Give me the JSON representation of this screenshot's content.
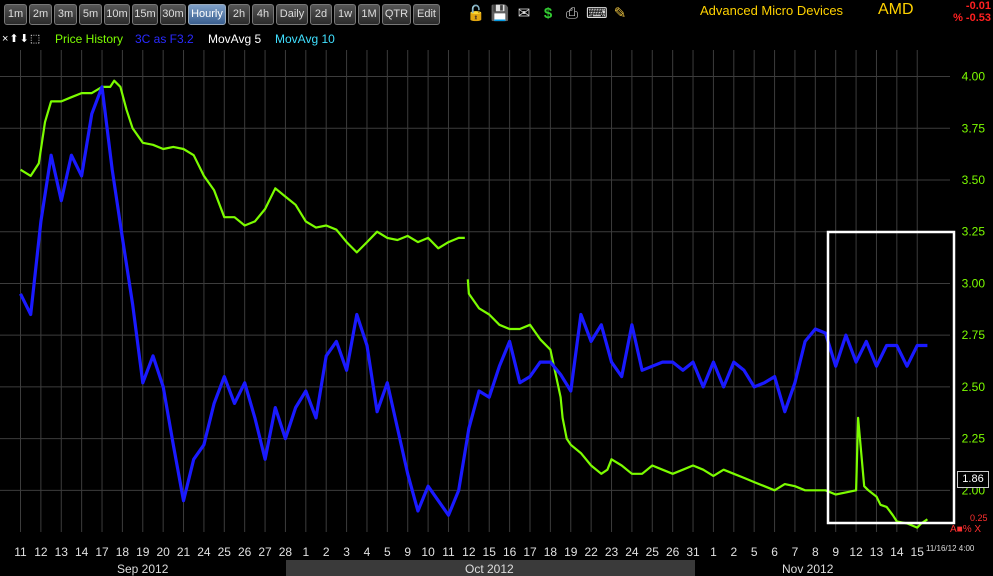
{
  "toolbar": {
    "timeframes": [
      "1m",
      "2m",
      "3m",
      "5m",
      "10m",
      "15m",
      "30m",
      "Hourly",
      "2h",
      "4h",
      "Daily",
      "2d",
      "1w",
      "1M",
      "QTR",
      "Edit"
    ],
    "active": "Hourly",
    "icons": [
      "lock-icon",
      "save-icon",
      "email-icon",
      "dollar-icon",
      "print-icon",
      "keyboard-icon",
      "pencil-icon"
    ],
    "company": "Advanced Micro Devices",
    "ticker": "AMD",
    "change": "-0.01",
    "change_pct": "% -0.53"
  },
  "legend": {
    "controls": "×⬆⬇⬚",
    "price_history": "Price History",
    "indicator": "3C as F3.2",
    "ma5": "MovAvg 5",
    "ma10": "MovAvg 10"
  },
  "colors": {
    "price": "#7cfc00",
    "indicator": "#1a1aff",
    "ma5": "#ffffff",
    "ma10": "#40e0ff",
    "axis_labels": "#7cfc00",
    "highlight_box": "#ffffff",
    "month_band_even": "#000000",
    "month_band_odd": "#3a3a3a"
  },
  "chart_data": {
    "type": "line",
    "title": "",
    "x_labels": [
      "11",
      "12",
      "13",
      "14",
      "17",
      "18",
      "19",
      "20",
      "21",
      "24",
      "25",
      "26",
      "27",
      "28",
      "1",
      "2",
      "3",
      "4",
      "5",
      "9",
      "10",
      "11",
      "12",
      "15",
      "16",
      "17",
      "18",
      "19",
      "22",
      "23",
      "24",
      "25",
      "26",
      "31",
      "1",
      "2",
      "5",
      "6",
      "7",
      "8",
      "9",
      "12",
      "13",
      "14",
      "15"
    ],
    "months": [
      "Sep 2012",
      "Oct 2012",
      "Nov 2012"
    ],
    "ylim": [
      1.76,
      4.08
    ],
    "y_ticks": [
      2.0,
      2.25,
      2.5,
      2.75,
      3.0,
      3.25,
      3.5,
      3.75,
      4.0
    ],
    "y_tick_labels": [
      "2.00",
      "2.25",
      "2.50",
      "2.75",
      "3.00",
      "3.25",
      "3.50",
      "3.75",
      "4.00"
    ],
    "last_price": "1.86",
    "lower_right_value": "0.25",
    "timestamp": "11/16/12 4:00",
    "grid": true,
    "series": [
      {
        "name": "Price History",
        "x": [
          0,
          0.5,
          0.9,
          1.2,
          1.5,
          2,
          2.5,
          3,
          3.5,
          4,
          4.4,
          4.6,
          4.9,
          5.2,
          5.5,
          6,
          6.5,
          7,
          7.5,
          8,
          8.5,
          9,
          9.5,
          10,
          10.5,
          11,
          11.5,
          12,
          12.5,
          13,
          13.5,
          14,
          14.5,
          15,
          15.5,
          16,
          16.5,
          17,
          17.5,
          18,
          18.5,
          19,
          19.5,
          20,
          20.5,
          21,
          21.5,
          21.8,
          21.95,
          22,
          22.5,
          23,
          23.5,
          24,
          24.5,
          25,
          25.5,
          26,
          26.5,
          26.6,
          26.8,
          27,
          27.5,
          28,
          28.5,
          28.8,
          29,
          29.5,
          30,
          30.5,
          31,
          31.5,
          32,
          32.5,
          33,
          33.5,
          34,
          34.5,
          35,
          35.5,
          36,
          36.5,
          37,
          37.5,
          38,
          38.5,
          39,
          39.5,
          40,
          40.5,
          41,
          41.1,
          41.4,
          41.6,
          42,
          42.2,
          42.5,
          42.8,
          43,
          43.5,
          44,
          44.2,
          44.5
        ],
        "values": [
          3.55,
          3.52,
          3.58,
          3.78,
          3.88,
          3.88,
          3.9,
          3.92,
          3.92,
          3.95,
          3.95,
          3.98,
          3.95,
          3.84,
          3.75,
          3.68,
          3.67,
          3.65,
          3.66,
          3.65,
          3.62,
          3.52,
          3.45,
          3.32,
          3.32,
          3.28,
          3.3,
          3.36,
          3.46,
          3.42,
          3.38,
          3.3,
          3.27,
          3.28,
          3.26,
          3.2,
          3.15,
          3.2,
          3.25,
          3.22,
          3.21,
          3.23,
          3.2,
          3.22,
          3.17,
          3.2,
          3.22,
          3.22,
          3.02,
          2.95,
          2.88,
          2.85,
          2.8,
          2.78,
          2.78,
          2.8,
          2.73,
          2.68,
          2.45,
          2.35,
          2.25,
          2.22,
          2.18,
          2.12,
          2.08,
          2.1,
          2.15,
          2.12,
          2.08,
          2.08,
          2.12,
          2.1,
          2.08,
          2.1,
          2.12,
          2.1,
          2.07,
          2.1,
          2.08,
          2.06,
          2.04,
          2.02,
          2.0,
          2.03,
          2.02,
          2.0,
          2.0,
          2.0,
          1.98,
          1.99,
          2.0,
          2.35,
          2.02,
          2.0,
          1.97,
          1.93,
          1.92,
          1.88,
          1.85,
          1.84,
          1.82,
          1.84,
          1.86
        ]
      },
      {
        "name": "3C as F3.2",
        "x": [
          0,
          0.5,
          1,
          1.5,
          2,
          2.5,
          3,
          3.5,
          4,
          4.5,
          5,
          5.5,
          6,
          6.5,
          7,
          7.5,
          8,
          8.5,
          9,
          9.5,
          10,
          10.5,
          11,
          11.5,
          12,
          12.5,
          13,
          13.5,
          14,
          14.5,
          15,
          15.5,
          16,
          16.5,
          17,
          17.5,
          18,
          18.5,
          19,
          19.5,
          20,
          20.5,
          21,
          21.5,
          22,
          22.5,
          23,
          23.5,
          24,
          24.5,
          25,
          25.5,
          26,
          26.5,
          27,
          27.5,
          28,
          28.5,
          29,
          29.5,
          30,
          30.5,
          31,
          31.5,
          32,
          32.5,
          33,
          33.5,
          34,
          34.5,
          35,
          35.5,
          36,
          36.5,
          37,
          37.5,
          38,
          38.5,
          39,
          39.5,
          40,
          40.5,
          41,
          41.5,
          42,
          42.5,
          43,
          43.5,
          44,
          44.5
        ],
        "values": [
          2.95,
          2.85,
          3.3,
          3.62,
          3.4,
          3.62,
          3.52,
          3.82,
          3.95,
          3.55,
          3.22,
          2.9,
          2.52,
          2.65,
          2.5,
          2.22,
          1.95,
          2.15,
          2.22,
          2.42,
          2.55,
          2.42,
          2.52,
          2.35,
          2.15,
          2.4,
          2.25,
          2.4,
          2.48,
          2.35,
          2.65,
          2.72,
          2.58,
          2.85,
          2.7,
          2.38,
          2.52,
          2.3,
          2.08,
          1.9,
          2.02,
          1.95,
          1.88,
          2.0,
          2.3,
          2.48,
          2.45,
          2.6,
          2.72,
          2.52,
          2.55,
          2.62,
          2.62,
          2.56,
          2.48,
          2.85,
          2.72,
          2.8,
          2.62,
          2.55,
          2.8,
          2.58,
          2.6,
          2.62,
          2.62,
          2.58,
          2.62,
          2.5,
          2.62,
          2.5,
          2.62,
          2.58,
          2.5,
          2.52,
          2.55,
          2.38,
          2.52,
          2.72,
          2.78,
          2.76,
          2.6,
          2.75,
          2.62,
          2.72,
          2.6,
          2.7,
          2.7,
          2.6,
          2.7,
          2.7
        ]
      }
    ]
  }
}
